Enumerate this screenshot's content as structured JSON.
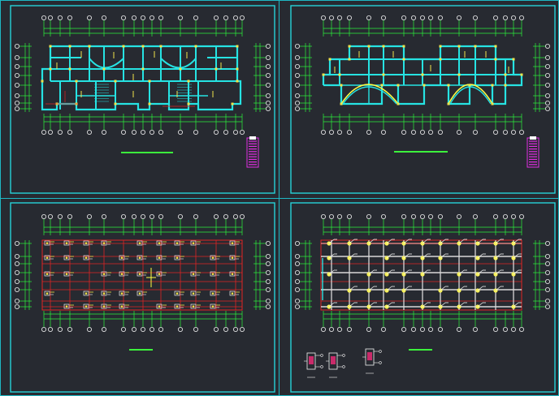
{
  "viewer": {
    "background": "#272a31",
    "panel_frame_color": "#27d3d8",
    "divider_color": "#1fb8c4"
  },
  "colors": {
    "wall": "#26e3e3",
    "column": "#f0e44a",
    "dim": "#2cf23c",
    "beam": "#e02424",
    "steel": "#d8d8d8",
    "magenta": "#e22ee2",
    "title": "#3cf23c",
    "detail": "#c92b6a"
  },
  "panels": [
    {
      "id": "floor-plan-1",
      "kind": "wall-plan-twin-arch-top"
    },
    {
      "id": "floor-plan-2",
      "kind": "wall-plan-twin-arch-bottom"
    },
    {
      "id": "foundation-plan",
      "kind": "column-beam-grid"
    },
    {
      "id": "column-layout-plan",
      "kind": "column-detail-grid"
    }
  ]
}
